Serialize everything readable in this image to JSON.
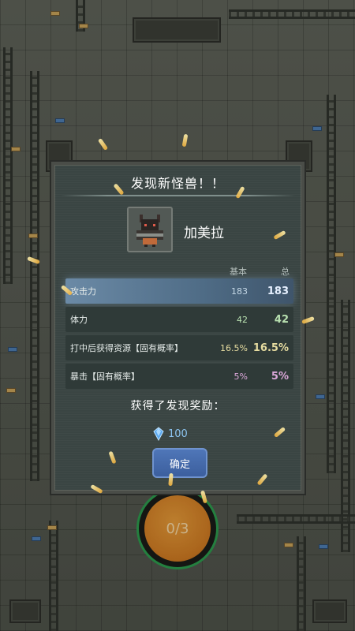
{
  "dialog": {
    "title": "发现新怪兽！！",
    "monster_name": "加美拉",
    "col_base": "基本",
    "col_total": "总",
    "stats": [
      {
        "label": "攻击力",
        "base": "183",
        "total": "183"
      },
      {
        "label": "体力",
        "base": "42",
        "total": "42"
      },
      {
        "label": "打中后获得资源【固有概率】",
        "base": "16.5%",
        "total": "16.5%"
      },
      {
        "label": "暴击【固有概率】",
        "base": "5%",
        "total": "5%"
      }
    ],
    "reward_title": "获得了发现奖励：",
    "reward_amount": "100",
    "reward_icon": "blue-gem-icon",
    "confirm_label": "确定"
  },
  "counter": {
    "text": "0/3"
  },
  "colors": {
    "dialog_bg": "#3a4543",
    "active_row": "#6b8aa6",
    "confirm": "#4f76b8",
    "orb": "#cf7a22",
    "stat_green": "#b8e0b0",
    "stat_yellow": "#e6dca0",
    "stat_pink": "#dba7d9"
  }
}
